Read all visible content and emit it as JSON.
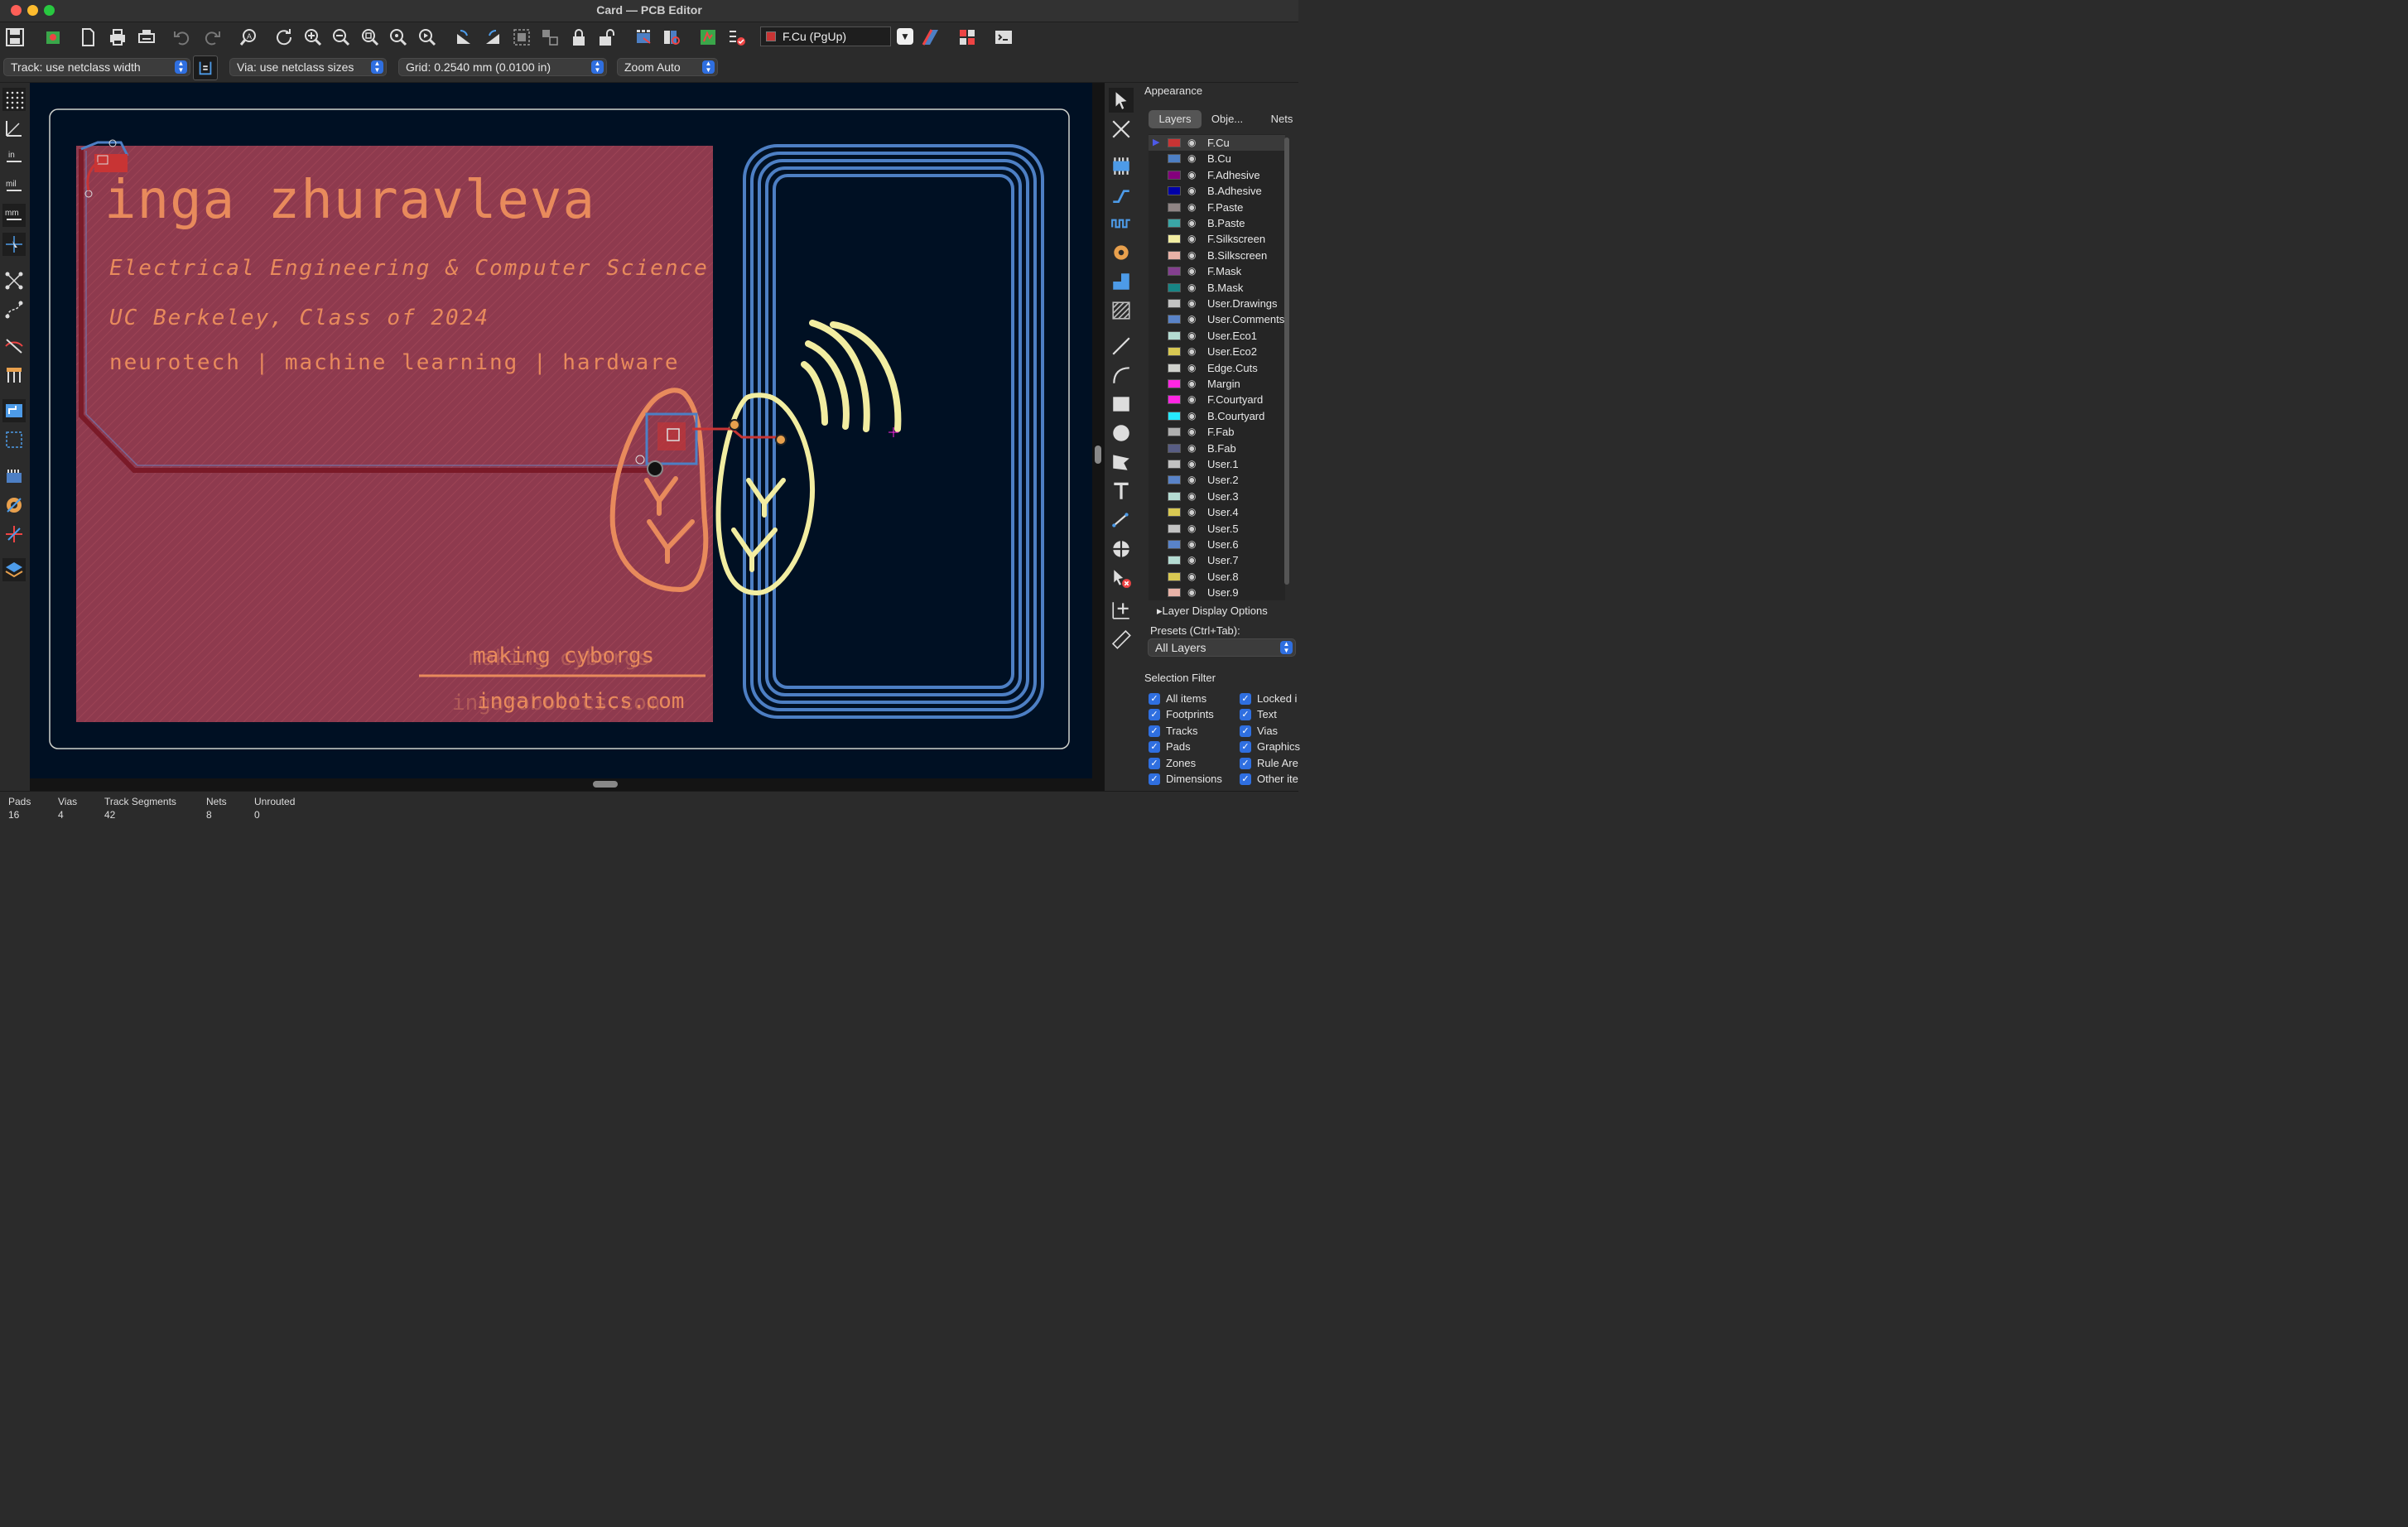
{
  "window": {
    "title": "Card — PCB Editor"
  },
  "toolbar": {
    "layer_selector": "F.Cu (PgUp)",
    "track_width": "Track: use netclass width",
    "via_size": "Via: use netclass sizes",
    "grid": "Grid: 0.2540 mm (0.0100 in)",
    "zoom": "Zoom Auto"
  },
  "board": {
    "name": "inga zhuravleva",
    "line1": "Electrical Engineering & Computer Science",
    "line2": "UC Berkeley, Class of 2024",
    "line3": "neurotech | machine learning | hardware",
    "tagline": "making cyborgs",
    "website": "ingarobotics.com",
    "tagline_back": "making cyborgs",
    "website_back": "ingarobotics.com"
  },
  "appearance": {
    "title": "Appearance",
    "tabs": [
      "Layers",
      "Obje...",
      "Nets"
    ],
    "active_tab": "Layers",
    "layers": [
      {
        "name": "F.Cu",
        "color": "#c83434"
      },
      {
        "name": "B.Cu",
        "color": "#4d7fc4"
      },
      {
        "name": "F.Adhesive",
        "color": "#84007c"
      },
      {
        "name": "B.Adhesive",
        "color": "#0000a8"
      },
      {
        "name": "F.Paste",
        "color": "#8f8484"
      },
      {
        "name": "B.Paste",
        "color": "#3aa6a6"
      },
      {
        "name": "F.Silkscreen",
        "color": "#f2eda1"
      },
      {
        "name": "B.Silkscreen",
        "color": "#e8b2a7"
      },
      {
        "name": "F.Mask",
        "color": "#843f8f"
      },
      {
        "name": "B.Mask",
        "color": "#178585"
      },
      {
        "name": "User.Drawings",
        "color": "#c2c2c2"
      },
      {
        "name": "User.Comments",
        "color": "#5983c8"
      },
      {
        "name": "User.Eco1",
        "color": "#b4dbd2"
      },
      {
        "name": "User.Eco2",
        "color": "#d8c852"
      },
      {
        "name": "Edge.Cuts",
        "color": "#d0d2cd"
      },
      {
        "name": "Margin",
        "color": "#ff26e2"
      },
      {
        "name": "F.Courtyard",
        "color": "#ff26e2"
      },
      {
        "name": "B.Courtyard",
        "color": "#26e9ff"
      },
      {
        "name": "F.Fab",
        "color": "#afafaf"
      },
      {
        "name": "B.Fab",
        "color": "#585d84"
      },
      {
        "name": "User.1",
        "color": "#c2c2c2"
      },
      {
        "name": "User.2",
        "color": "#5983c8"
      },
      {
        "name": "User.3",
        "color": "#b4dbd2"
      },
      {
        "name": "User.4",
        "color": "#d8c852"
      },
      {
        "name": "User.5",
        "color": "#c2c2c2"
      },
      {
        "name": "User.6",
        "color": "#5983c8"
      },
      {
        "name": "User.7",
        "color": "#b4dbd2"
      },
      {
        "name": "User.8",
        "color": "#d8c852"
      },
      {
        "name": "User.9",
        "color": "#e8b2a7"
      }
    ],
    "layer_display_options": "Layer Display Options",
    "presets_label": "Presets (Ctrl+Tab):",
    "presets_value": "All Layers"
  },
  "selection_filter": {
    "title": "Selection Filter",
    "col1": [
      "All items",
      "Footprints",
      "Tracks",
      "Pads",
      "Zones",
      "Dimensions"
    ],
    "col2": [
      "Locked i",
      "Text",
      "Vias",
      "Graphics",
      "Rule Are",
      "Other ite"
    ]
  },
  "status": {
    "pads_label": "Pads",
    "pads": "16",
    "vias_label": "Vias",
    "vias": "4",
    "tracks_label": "Track Segments",
    "tracks": "42",
    "nets_label": "Nets",
    "nets": "8",
    "unrouted_label": "Unrouted",
    "unrouted": "0"
  },
  "colors": {
    "accent": "#2f6fe0",
    "board_bg": "#001023",
    "front_copper": "#c83434",
    "back_copper": "#4d7fc4",
    "silkscreen": "#f2eda1",
    "back_silk": "#e88a5c"
  }
}
